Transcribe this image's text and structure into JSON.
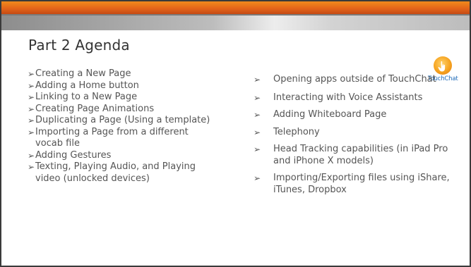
{
  "slide": {
    "title": "Part 2 Agenda",
    "logo": {
      "icon": "touchchat-hand-icon",
      "text": "TouchChat"
    },
    "bullet_glyph": "➢",
    "left_items": [
      "Creating a New Page",
      "Adding a Home button",
      "Linking to a New Page",
      "Creating Page Animations",
      "Duplicating a Page (Using a template)",
      "Importing a Page from a different vocab file",
      "Adding Gestures",
      "Texting, Playing Audio, and Playing video (unlocked devices)"
    ],
    "right_items": [
      "Opening apps outside of TouchChat",
      "Interacting with Voice Assistants",
      "Adding Whiteboard Page",
      "Telephony",
      "Head Tracking capabilities (in iPad Pro and iPhone X models)",
      "Importing/Exporting files using iShare, iTunes, Dropbox"
    ],
    "colors": {
      "accent_orange": "#e4651a",
      "text": "#555555",
      "title": "#333333",
      "logo_text": "#1f6bb8"
    }
  }
}
